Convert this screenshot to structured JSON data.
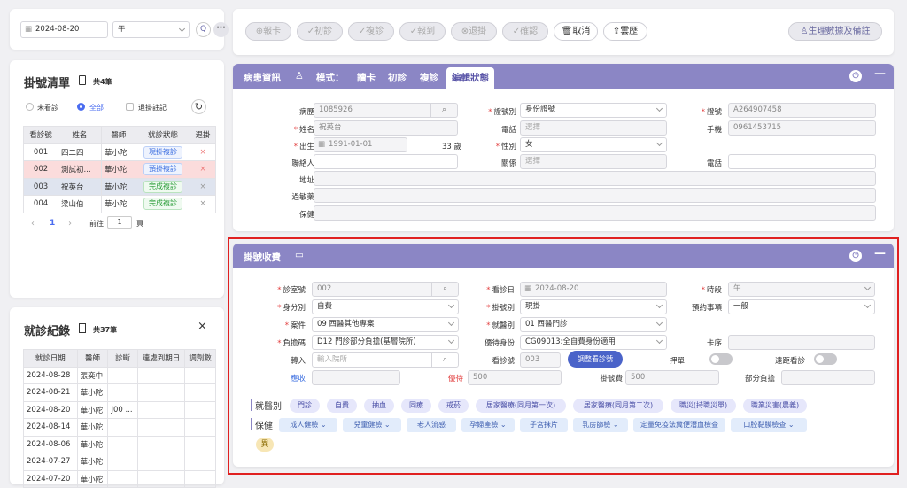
{
  "top": {
    "date": "2024-08-20",
    "period": "午",
    "search": "Q",
    "more": "···"
  },
  "toolbar": {
    "buttons": [
      "⊕報卡",
      "✓初診",
      "✓複診",
      "✓報到",
      "⊗退掛",
      "✓確認",
      "取消",
      "雲歷"
    ],
    "right": "生理數據及備註"
  },
  "reg_list": {
    "title": "掛號清單",
    "count": "共4筆",
    "filters": [
      "未看診",
      "全部",
      "退掛註記"
    ],
    "headers": [
      "看診號",
      "姓名",
      "醫師",
      "就診狀態",
      "退掛"
    ],
    "rows": [
      {
        "no": "001",
        "name": "四二四",
        "doc": "華小陀",
        "status": "現掛複診",
        "x": "×"
      },
      {
        "no": "002",
        "name": "測試初...",
        "doc": "華小陀",
        "status": "預掛複診",
        "x": "×"
      },
      {
        "no": "003",
        "name": "祝英台",
        "doc": "華小陀",
        "status": "完成複診",
        "x": "×"
      },
      {
        "no": "004",
        "name": "梁山伯",
        "doc": "華小陀",
        "status": "完成複診",
        "x": "×"
      }
    ],
    "pager": {
      "prev": "‹",
      "page": "1",
      "next": "›",
      "goto": "前往",
      "input": "1",
      "unit": "頁"
    }
  },
  "visit": {
    "title": "就診紀錄",
    "count": "共37筆",
    "close": "×",
    "headers": [
      "就診日期",
      "醫師",
      "診斷",
      "連處到期日",
      "調劑數"
    ],
    "rows": [
      [
        "2024-08-28",
        "張奕中",
        "",
        "",
        ""
      ],
      [
        "2024-08-21",
        "華小陀",
        "",
        "",
        ""
      ],
      [
        "2024-08-20",
        "華小陀",
        "J00 ...",
        "",
        ""
      ],
      [
        "2024-08-14",
        "華小陀",
        "",
        "",
        ""
      ],
      [
        "2024-08-06",
        "華小陀",
        "",
        "",
        ""
      ],
      [
        "2024-07-27",
        "華小陀",
        "",
        "",
        ""
      ],
      [
        "2024-07-20",
        "華小陀",
        "",
        "",
        ""
      ]
    ]
  },
  "patient": {
    "title": "病患資訊",
    "mode_label": "模式：",
    "modes": [
      "讀卡",
      "初診",
      "複診",
      "編輯狀態"
    ],
    "labels": {
      "chart": "病歷",
      "name": "姓名",
      "birth": "出生",
      "contact": "聯絡人",
      "address": "地址",
      "allergy": "過敏藥",
      "insurance": "保健",
      "id_type": "證號別",
      "phone": "電話",
      "gender": "性別",
      "relation": "關係",
      "id_no": "證號",
      "mobile": "手機",
      "phone2": "電話"
    },
    "values": {
      "chart": "1085926",
      "name": "祝英台",
      "birth": "1991-01-01",
      "age": "33 歲",
      "id_type": "身份證號",
      "phone_ph": "選擇",
      "gender": "女",
      "relation_ph": "選擇",
      "id_no": "A264907458",
      "mobile": "0961453715"
    }
  },
  "fee": {
    "title": "掛號收費",
    "labels": {
      "room": "診室號",
      "identity": "身分別",
      "case": "案件",
      "copay": "負擔碼",
      "transfer": "轉入",
      "receivable": "應收",
      "visit_date": "看診日",
      "reg_type": "掛號別",
      "dept": "就醫別",
      "discount": "優待身份",
      "seq": "看診號",
      "promo": "優待",
      "period": "時段",
      "notice": "預約事項",
      "card_seq": "卡序",
      "pledge": "押單",
      "delay": "遠距看診",
      "reg_fee": "掛號費",
      "part_fee": "部分負擔"
    },
    "values": {
      "room": "002",
      "identity": "自費",
      "case": "09 西醫其他專案",
      "copay": "D12 門診部分負擔(基層院所)",
      "transfer_ph": "輸入院所",
      "visit_date": "2024-08-20",
      "reg_type": "現掛",
      "dept": "01 西醫門診",
      "discount": "CG09013:全自費身份適用",
      "seq": "003",
      "adjust": "調整看診號",
      "period": "午",
      "notice": "一般",
      "promo_val": "500",
      "reg_fee": "500"
    },
    "jiuyi_label": "就醫別",
    "jiuyi": [
      "門診",
      "自費",
      "抽血",
      "同療",
      "戒菸",
      "居家醫療(同月第一次)",
      "居家醫療(同月第二次)",
      "職災(持職災單)",
      "職業災害(農義)"
    ],
    "baojian_label": "保健",
    "baojian": [
      "成人健檢",
      "兒童健檢",
      "老人流感",
      "孕婦產檢",
      "子宮抹片",
      "乳房篩檢",
      "定量免疫法糞便潛血檢查",
      "口腔黏膜檢查"
    ],
    "extra": "異"
  }
}
